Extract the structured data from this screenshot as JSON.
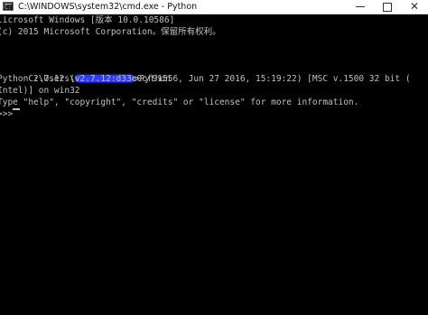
{
  "window": {
    "title": "C:\\WINDOWS\\system32\\cmd.exe - Python",
    "icon_name": "cmd-icon",
    "buttons": {
      "minimize": "minimize-icon",
      "maximize": "maximize-icon",
      "close": "✕"
    }
  },
  "console": {
    "lines": [
      "licrosoft Windows [版本 10.0.10586]",
      "(c) 2015 Microsoft Corporation。保留所有权利。",
      "",
      "",
      "",
      "",
      "",
      "",
      "",
      "",
      "",
      "",
      "",
      "",
      "",
      "",
      "",
      ""
    ],
    "prompt_path_prefix": "C:\\Users\\",
    "prompt_path_suffix": ">Python",
    "python_version_line": "Python 2.7.12 (v2.7.12:d33e0cf91556, Jun 27 2016, 15:19:22) [MSC v.1500 32 bit (",
    "intel_line": "Intel)] on win32",
    "help_line": "Type \"help\", \"copyright\", \"credits\" or \"license\" for more information.",
    "repl_prompt": ">>> ",
    "cursor_style": "underscore"
  },
  "colors": {
    "console_bg": "#000000",
    "console_text": "#c0c0c0",
    "title_bg": "#ffffff",
    "title_text": "#111111",
    "redaction": "#2d3cff"
  }
}
